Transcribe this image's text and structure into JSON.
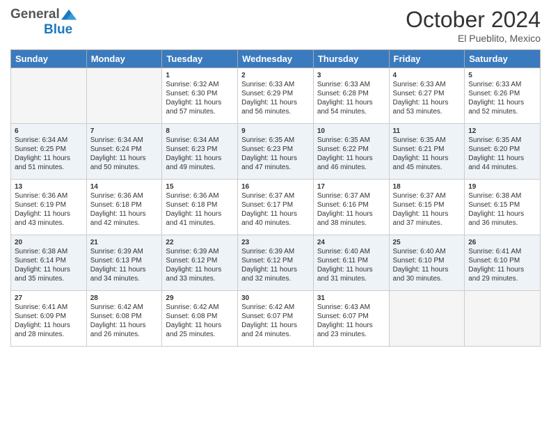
{
  "header": {
    "logo_line1": "General",
    "logo_line2": "Blue",
    "month": "October 2024",
    "location": "El Pueblito, Mexico"
  },
  "weekdays": [
    "Sunday",
    "Monday",
    "Tuesday",
    "Wednesday",
    "Thursday",
    "Friday",
    "Saturday"
  ],
  "weeks": [
    [
      {
        "day": "",
        "sunrise": "",
        "sunset": "",
        "daylight": ""
      },
      {
        "day": "",
        "sunrise": "",
        "sunset": "",
        "daylight": ""
      },
      {
        "day": "1",
        "sunrise": "Sunrise: 6:32 AM",
        "sunset": "Sunset: 6:30 PM",
        "daylight": "Daylight: 11 hours and 57 minutes."
      },
      {
        "day": "2",
        "sunrise": "Sunrise: 6:33 AM",
        "sunset": "Sunset: 6:29 PM",
        "daylight": "Daylight: 11 hours and 56 minutes."
      },
      {
        "day": "3",
        "sunrise": "Sunrise: 6:33 AM",
        "sunset": "Sunset: 6:28 PM",
        "daylight": "Daylight: 11 hours and 54 minutes."
      },
      {
        "day": "4",
        "sunrise": "Sunrise: 6:33 AM",
        "sunset": "Sunset: 6:27 PM",
        "daylight": "Daylight: 11 hours and 53 minutes."
      },
      {
        "day": "5",
        "sunrise": "Sunrise: 6:33 AM",
        "sunset": "Sunset: 6:26 PM",
        "daylight": "Daylight: 11 hours and 52 minutes."
      }
    ],
    [
      {
        "day": "6",
        "sunrise": "Sunrise: 6:34 AM",
        "sunset": "Sunset: 6:25 PM",
        "daylight": "Daylight: 11 hours and 51 minutes."
      },
      {
        "day": "7",
        "sunrise": "Sunrise: 6:34 AM",
        "sunset": "Sunset: 6:24 PM",
        "daylight": "Daylight: 11 hours and 50 minutes."
      },
      {
        "day": "8",
        "sunrise": "Sunrise: 6:34 AM",
        "sunset": "Sunset: 6:23 PM",
        "daylight": "Daylight: 11 hours and 49 minutes."
      },
      {
        "day": "9",
        "sunrise": "Sunrise: 6:35 AM",
        "sunset": "Sunset: 6:23 PM",
        "daylight": "Daylight: 11 hours and 47 minutes."
      },
      {
        "day": "10",
        "sunrise": "Sunrise: 6:35 AM",
        "sunset": "Sunset: 6:22 PM",
        "daylight": "Daylight: 11 hours and 46 minutes."
      },
      {
        "day": "11",
        "sunrise": "Sunrise: 6:35 AM",
        "sunset": "Sunset: 6:21 PM",
        "daylight": "Daylight: 11 hours and 45 minutes."
      },
      {
        "day": "12",
        "sunrise": "Sunrise: 6:35 AM",
        "sunset": "Sunset: 6:20 PM",
        "daylight": "Daylight: 11 hours and 44 minutes."
      }
    ],
    [
      {
        "day": "13",
        "sunrise": "Sunrise: 6:36 AM",
        "sunset": "Sunset: 6:19 PM",
        "daylight": "Daylight: 11 hours and 43 minutes."
      },
      {
        "day": "14",
        "sunrise": "Sunrise: 6:36 AM",
        "sunset": "Sunset: 6:18 PM",
        "daylight": "Daylight: 11 hours and 42 minutes."
      },
      {
        "day": "15",
        "sunrise": "Sunrise: 6:36 AM",
        "sunset": "Sunset: 6:18 PM",
        "daylight": "Daylight: 11 hours and 41 minutes."
      },
      {
        "day": "16",
        "sunrise": "Sunrise: 6:37 AM",
        "sunset": "Sunset: 6:17 PM",
        "daylight": "Daylight: 11 hours and 40 minutes."
      },
      {
        "day": "17",
        "sunrise": "Sunrise: 6:37 AM",
        "sunset": "Sunset: 6:16 PM",
        "daylight": "Daylight: 11 hours and 38 minutes."
      },
      {
        "day": "18",
        "sunrise": "Sunrise: 6:37 AM",
        "sunset": "Sunset: 6:15 PM",
        "daylight": "Daylight: 11 hours and 37 minutes."
      },
      {
        "day": "19",
        "sunrise": "Sunrise: 6:38 AM",
        "sunset": "Sunset: 6:15 PM",
        "daylight": "Daylight: 11 hours and 36 minutes."
      }
    ],
    [
      {
        "day": "20",
        "sunrise": "Sunrise: 6:38 AM",
        "sunset": "Sunset: 6:14 PM",
        "daylight": "Daylight: 11 hours and 35 minutes."
      },
      {
        "day": "21",
        "sunrise": "Sunrise: 6:39 AM",
        "sunset": "Sunset: 6:13 PM",
        "daylight": "Daylight: 11 hours and 34 minutes."
      },
      {
        "day": "22",
        "sunrise": "Sunrise: 6:39 AM",
        "sunset": "Sunset: 6:12 PM",
        "daylight": "Daylight: 11 hours and 33 minutes."
      },
      {
        "day": "23",
        "sunrise": "Sunrise: 6:39 AM",
        "sunset": "Sunset: 6:12 PM",
        "daylight": "Daylight: 11 hours and 32 minutes."
      },
      {
        "day": "24",
        "sunrise": "Sunrise: 6:40 AM",
        "sunset": "Sunset: 6:11 PM",
        "daylight": "Daylight: 11 hours and 31 minutes."
      },
      {
        "day": "25",
        "sunrise": "Sunrise: 6:40 AM",
        "sunset": "Sunset: 6:10 PM",
        "daylight": "Daylight: 11 hours and 30 minutes."
      },
      {
        "day": "26",
        "sunrise": "Sunrise: 6:41 AM",
        "sunset": "Sunset: 6:10 PM",
        "daylight": "Daylight: 11 hours and 29 minutes."
      }
    ],
    [
      {
        "day": "27",
        "sunrise": "Sunrise: 6:41 AM",
        "sunset": "Sunset: 6:09 PM",
        "daylight": "Daylight: 11 hours and 28 minutes."
      },
      {
        "day": "28",
        "sunrise": "Sunrise: 6:42 AM",
        "sunset": "Sunset: 6:08 PM",
        "daylight": "Daylight: 11 hours and 26 minutes."
      },
      {
        "day": "29",
        "sunrise": "Sunrise: 6:42 AM",
        "sunset": "Sunset: 6:08 PM",
        "daylight": "Daylight: 11 hours and 25 minutes."
      },
      {
        "day": "30",
        "sunrise": "Sunrise: 6:42 AM",
        "sunset": "Sunset: 6:07 PM",
        "daylight": "Daylight: 11 hours and 24 minutes."
      },
      {
        "day": "31",
        "sunrise": "Sunrise: 6:43 AM",
        "sunset": "Sunset: 6:07 PM",
        "daylight": "Daylight: 11 hours and 23 minutes."
      },
      {
        "day": "",
        "sunrise": "",
        "sunset": "",
        "daylight": ""
      },
      {
        "day": "",
        "sunrise": "",
        "sunset": "",
        "daylight": ""
      }
    ]
  ]
}
